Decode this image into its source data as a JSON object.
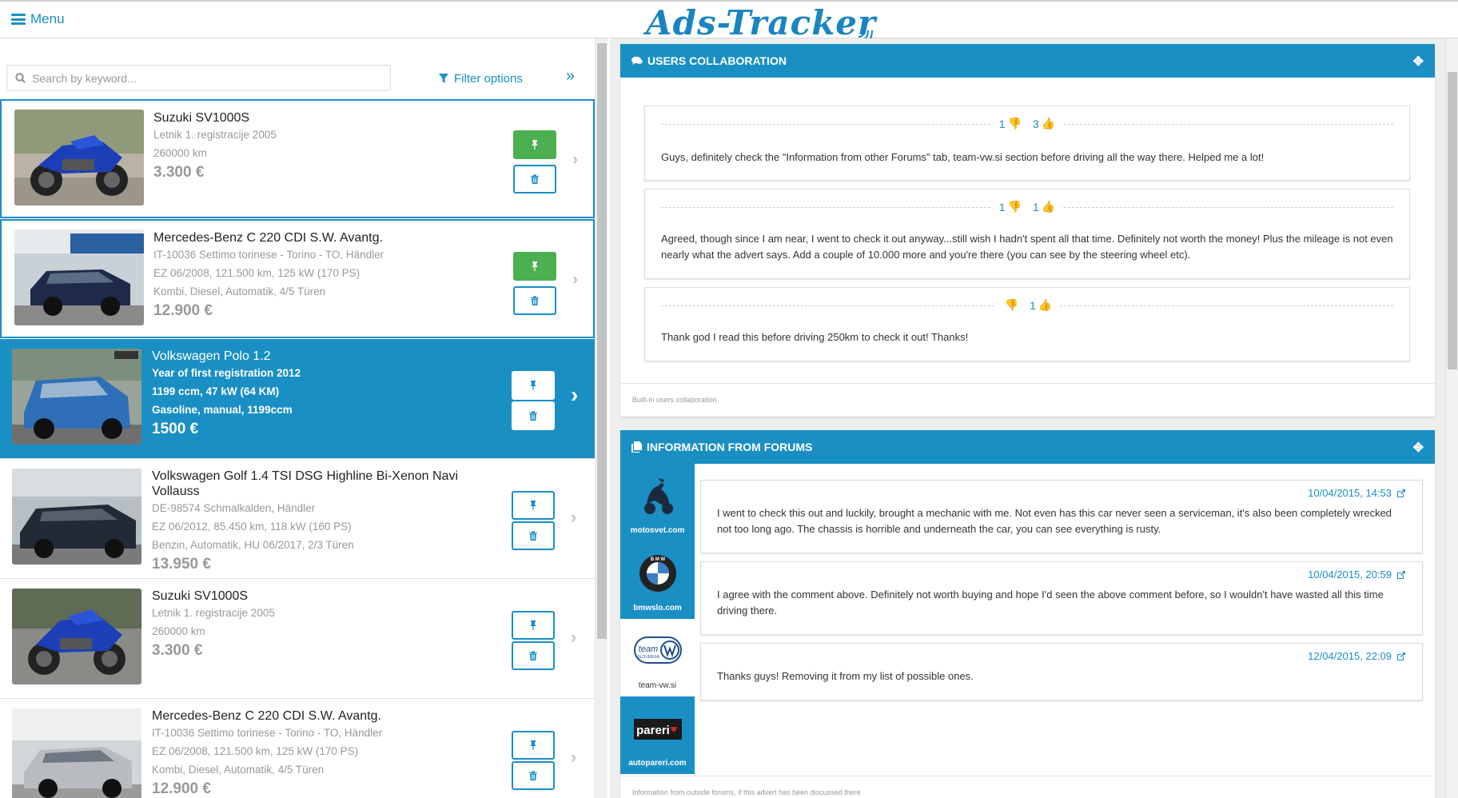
{
  "header": {
    "menu_label": "Menu",
    "logo_text": "Ads-Tracker"
  },
  "search": {
    "placeholder": "Search by keyword..."
  },
  "filter_label": "Filter options",
  "listings": [
    {
      "title": "Suzuki SV1000S",
      "lines": [
        "Letnik 1. registracije 2005",
        "260000 km"
      ],
      "price": "3.300 €",
      "state": "saved",
      "pinned": true
    },
    {
      "title": "Mercedes-Benz C 220 CDI S.W. Avantg.",
      "lines": [
        "IT-10036 Settimo torinese - Torino - TO, Händler",
        "EZ 06/2008, 121.500 km, 125 kW (170 PS)",
        "Kombi, Diesel, Automatik, 4/5 Türen"
      ],
      "price": "12.900 €",
      "state": "saved",
      "pinned": true
    },
    {
      "title": "Volkswagen Polo 1.2",
      "lines": [
        "Year of first registration 2012",
        "1199 ccm, 47 kW (64 KM)",
        "Gasoline, manual, 1199ccm"
      ],
      "price": "1500 €",
      "state": "selected",
      "pinned": false
    },
    {
      "title": "Volkswagen Golf 1.4 TSI DSG Highline Bi-Xenon Navi Vollauss",
      "lines": [
        "DE-98574 Schmalkalden, Händler",
        "EZ 06/2012, 85.450 km, 118 kW (160 PS)",
        "Benzin, Automatik, HU 06/2017, 2/3 Türen"
      ],
      "price": "13.950 €",
      "state": "normal",
      "pinned": false
    },
    {
      "title": "Suzuki SV1000S",
      "lines": [
        "Letnik 1. registracije 2005",
        "260000 km"
      ],
      "price": "3.300 €",
      "state": "normal",
      "pinned": false
    },
    {
      "title": "Mercedes-Benz C 220 CDI S.W. Avantg.",
      "lines": [
        "IT-10036 Settimo torinese - Torino - TO, Händler",
        "EZ 06/2008, 121.500 km, 125 kW (170 PS)",
        "Kombi, Diesel, Automatik, 4/5 Türen"
      ],
      "price": "12.900 €",
      "state": "normal",
      "pinned": false
    }
  ],
  "collaboration": {
    "title": "USERS COLLABORATION",
    "footer": "Built-in users collaboration",
    "comments": [
      {
        "dislikes": "1",
        "likes": "3",
        "text": "Guys, definitely check the \"Information from other Forums\" tab, team-vw.si section before driving all the way there. Helped me a lot!"
      },
      {
        "dislikes": "1",
        "likes": "1",
        "text": "Agreed, though since I am near, I went to check it out anyway...still wish I hadn't spent all that time. Definitely not worth the money! Plus the mileage is not even nearly what the advert says. Add a couple of 10.000 more and you're there (you can see by the steering wheel etc)."
      },
      {
        "dislikes": "",
        "likes": "1",
        "text": "Thank god I read this before driving 250km to check it out! Thanks!"
      }
    ]
  },
  "forums": {
    "title": "INFORMATION FROM FORUMS",
    "footer": "Information from outside forums, if this advert has been discussed there",
    "sources": [
      {
        "name": "motosvet.com",
        "active": false
      },
      {
        "name": "bmwslo.com",
        "active": false
      },
      {
        "name": "team-vw.si",
        "active": true
      },
      {
        "name": "autopareri.com",
        "active": false
      }
    ],
    "logo_texts": {
      "team": "team",
      "slovenija": "SLOVENIJA",
      "pareri": "pareri"
    },
    "posts": [
      {
        "date": "10/04/2015, 14:53",
        "text": "I went to check this out and luckily, brought a mechanic with me. Not even has this car never seen a serviceman, it's also been completely wrecked not too long ago. The chassis is horrible and underneath the car, you can see everything is rusty."
      },
      {
        "date": "10/04/2015, 20:59",
        "text": "I agree with the comment above. Definitely not worth buying and hope I'd seen the above comment before, so I wouldn't have wasted all this time driving there."
      },
      {
        "date": "12/04/2015, 22:09",
        "text": "Thanks guys! Removing it from my list of possible ones."
      }
    ]
  },
  "colors": {
    "accent": "#1a8fc4",
    "pinned": "#4caf50"
  },
  "icons": [
    "menu-icon",
    "search-icon",
    "filter-icon",
    "collapse-icon",
    "pin-icon",
    "trash-icon",
    "chevron-right-icon",
    "comments-icon",
    "move-icon",
    "thumbs-down-icon",
    "thumbs-up-icon",
    "file-icon",
    "external-link-icon"
  ]
}
